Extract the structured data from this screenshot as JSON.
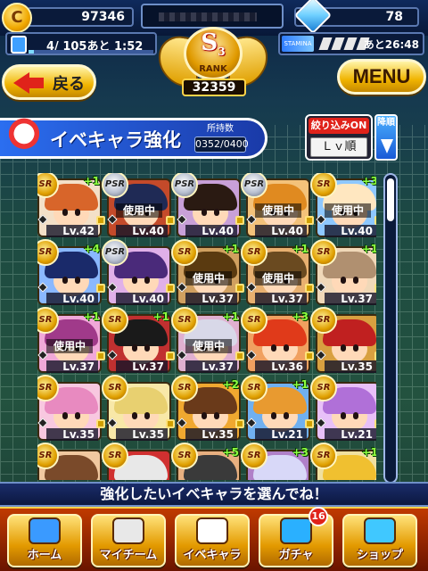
{
  "header": {
    "coins": "97346",
    "gems": "78",
    "stamina_text": "4/ 105あと  1:52",
    "stamina_fraction": 0.04,
    "pbox_time": "あと26:48",
    "pbox_label": "STAMINA",
    "coin_symbol": "C"
  },
  "rank": {
    "letter": "S",
    "sub": "3",
    "label": "RANK",
    "score": "32359"
  },
  "nav_top": {
    "back_label": "戻る",
    "menu_label": "MENU"
  },
  "title": {
    "text": "イベキャラ強化",
    "owned_label": "所持数",
    "owned_value": "0352/0400"
  },
  "filter": {
    "status": "絞り込みON",
    "sort": "Ｌｖ順",
    "order": "降順"
  },
  "cards": [
    {
      "rarity": "SR",
      "plus": "+1",
      "level": "Lv.42",
      "in_use": "",
      "hair": "#d8652a",
      "bg": "#f3e0c8"
    },
    {
      "rarity": "PSR",
      "plus": "",
      "level": "Lv.40",
      "in_use": "使用中",
      "hair": "#1f2a55",
      "bg": "#c44a2a"
    },
    {
      "rarity": "PSR",
      "plus": "",
      "level": "Lv.40",
      "in_use": "",
      "hair": "#2a1a12",
      "bg": "#c8a0d8"
    },
    {
      "rarity": "PSR",
      "plus": "",
      "level": "Lv.40",
      "in_use": "使用中",
      "hair": "#e08a20",
      "bg": "#f3c27a"
    },
    {
      "rarity": "SR",
      "plus": "+3",
      "level": "Lv.40",
      "in_use": "使用中",
      "hair": "#ffe7c0",
      "bg": "#8ec8ff"
    },
    {
      "rarity": "SR",
      "plus": "+4",
      "level": "Lv.40",
      "in_use": "",
      "hair": "#1a2a6a",
      "bg": "#8ab8ff"
    },
    {
      "rarity": "PSR",
      "plus": "",
      "level": "Lv.40",
      "in_use": "",
      "hair": "#4a2a7a",
      "bg": "#e0b0e8"
    },
    {
      "rarity": "SR",
      "plus": "+1",
      "level": "Lv.37",
      "in_use": "使用中",
      "hair": "#5a3a10",
      "bg": "#d0a060"
    },
    {
      "rarity": "SR",
      "plus": "+1",
      "level": "Lv.37",
      "in_use": "使用中",
      "hair": "#6a4a20",
      "bg": "#e8b070"
    },
    {
      "rarity": "SR",
      "plus": "+1",
      "level": "Lv.37",
      "in_use": "",
      "hair": "#b09070",
      "bg": "#f0d8b8"
    },
    {
      "rarity": "SR",
      "plus": "+1",
      "level": "Lv.37",
      "in_use": "使用中",
      "hair": "#a03a8a",
      "bg": "#f0a8d8"
    },
    {
      "rarity": "SR",
      "plus": "+1",
      "level": "Lv.37",
      "in_use": "",
      "hair": "#1a1a1a",
      "bg": "#c03030"
    },
    {
      "rarity": "SR",
      "plus": "+1",
      "level": "Lv.37",
      "in_use": "使用中",
      "hair": "#d8d8e8",
      "bg": "#e0b0d0"
    },
    {
      "rarity": "SR",
      "plus": "+3",
      "level": "Lv.36",
      "in_use": "",
      "hair": "#e03a1a",
      "bg": "#f0a060"
    },
    {
      "rarity": "SR",
      "plus": "",
      "level": "Lv.35",
      "in_use": "",
      "hair": "#c02020",
      "bg": "#d8a040"
    },
    {
      "rarity": "SR",
      "plus": "",
      "level": "Lv.35",
      "in_use": "",
      "hair": "#e88ac0",
      "bg": "#f8c8e0"
    },
    {
      "rarity": "SR",
      "plus": "",
      "level": "Lv.35",
      "in_use": "",
      "hair": "#e8d070",
      "bg": "#f8e8a8"
    },
    {
      "rarity": "SR",
      "plus": "+2",
      "level": "Lv.35",
      "in_use": "",
      "hair": "#6a3a1a",
      "bg": "#f0a830"
    },
    {
      "rarity": "SR",
      "plus": "+1",
      "level": "Lv.21",
      "in_use": "",
      "hair": "#e89a30",
      "bg": "#70b0f0"
    },
    {
      "rarity": "SR",
      "plus": "",
      "level": "Lv.21",
      "in_use": "",
      "hair": "#b070d8",
      "bg": "#e8c0f8"
    },
    {
      "rarity": "SR",
      "plus": "",
      "level": "",
      "in_use": "",
      "hair": "#7a4a2a",
      "bg": "#f0c8a0"
    },
    {
      "rarity": "SR",
      "plus": "",
      "level": "",
      "in_use": "",
      "hair": "#e8e8e8",
      "bg": "#d03030"
    },
    {
      "rarity": "SR",
      "plus": "+5",
      "level": "",
      "in_use": "",
      "hair": "#3a3a3a",
      "bg": "#e8b080"
    },
    {
      "rarity": "SR",
      "plus": "+3",
      "level": "",
      "in_use": "",
      "hair": "#d8d8f8",
      "bg": "#b080c8"
    },
    {
      "rarity": "SR",
      "plus": "+1",
      "level": "",
      "in_use": "",
      "hair": "#f0c030",
      "bg": "#f0e0a0"
    }
  ],
  "scroll_fraction": 0.0,
  "message": "強化したいイベキャラを選んでね！",
  "bottom_nav": [
    {
      "label": "ホーム",
      "icon": "home-icon",
      "color": "#3a9aff"
    },
    {
      "label": "マイチーム",
      "icon": "team-icon",
      "color": "#e8e8e8"
    },
    {
      "label": "イベキャラ",
      "icon": "event-chara-icon",
      "color": "#ffffff"
    },
    {
      "label": "ガチャ",
      "icon": "gacha-icon",
      "color": "#2ab0ff"
    },
    {
      "label": "ショップ",
      "icon": "shop-icon",
      "color": "#40c8ff"
    }
  ],
  "gacha_badge": "16"
}
